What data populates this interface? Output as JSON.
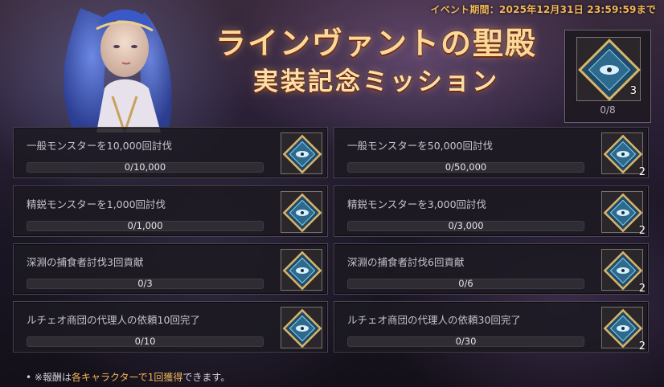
{
  "event_period": "イベント期間：2025年12月31日 23:59:59まで",
  "banner": {
    "title_line1": "ラインヴァントの聖殿",
    "title_line2": "実装記念ミッション"
  },
  "grand_reward": {
    "icon": "eye-crest-token-icon",
    "count": "3",
    "progress": "0/8"
  },
  "missions": [
    {
      "label": "一般モンスターを10,000回討伐",
      "progress": "0/10,000",
      "fraction": 0,
      "reward_count": ""
    },
    {
      "label": "一般モンスターを50,000回討伐",
      "progress": "0/50,000",
      "fraction": 0,
      "reward_count": "2"
    },
    {
      "label": "精鋭モンスターを1,000回討伐",
      "progress": "0/1,000",
      "fraction": 0,
      "reward_count": ""
    },
    {
      "label": "精鋭モンスターを3,000回討伐",
      "progress": "0/3,000",
      "fraction": 0,
      "reward_count": "2"
    },
    {
      "label": "深淵の捕食者討伐3回貢献",
      "progress": "0/3",
      "fraction": 0,
      "reward_count": ""
    },
    {
      "label": "深淵の捕食者討伐6回貢献",
      "progress": "0/6",
      "fraction": 0,
      "reward_count": "2"
    },
    {
      "label": "ルチェオ商団の代理人の依頼10回完了",
      "progress": "0/10",
      "fraction": 0,
      "reward_count": ""
    },
    {
      "label": "ルチェオ商団の代理人の依頼30回完了",
      "progress": "0/30",
      "fraction": 0,
      "reward_count": "2"
    }
  ],
  "note": {
    "bullet": "•",
    "prefix": "※報酬は",
    "highlight": "各キャラクターで1回獲得",
    "suffix": "できます。"
  },
  "colors": {
    "accent": "#f2b75a",
    "title": "#fbd896"
  }
}
